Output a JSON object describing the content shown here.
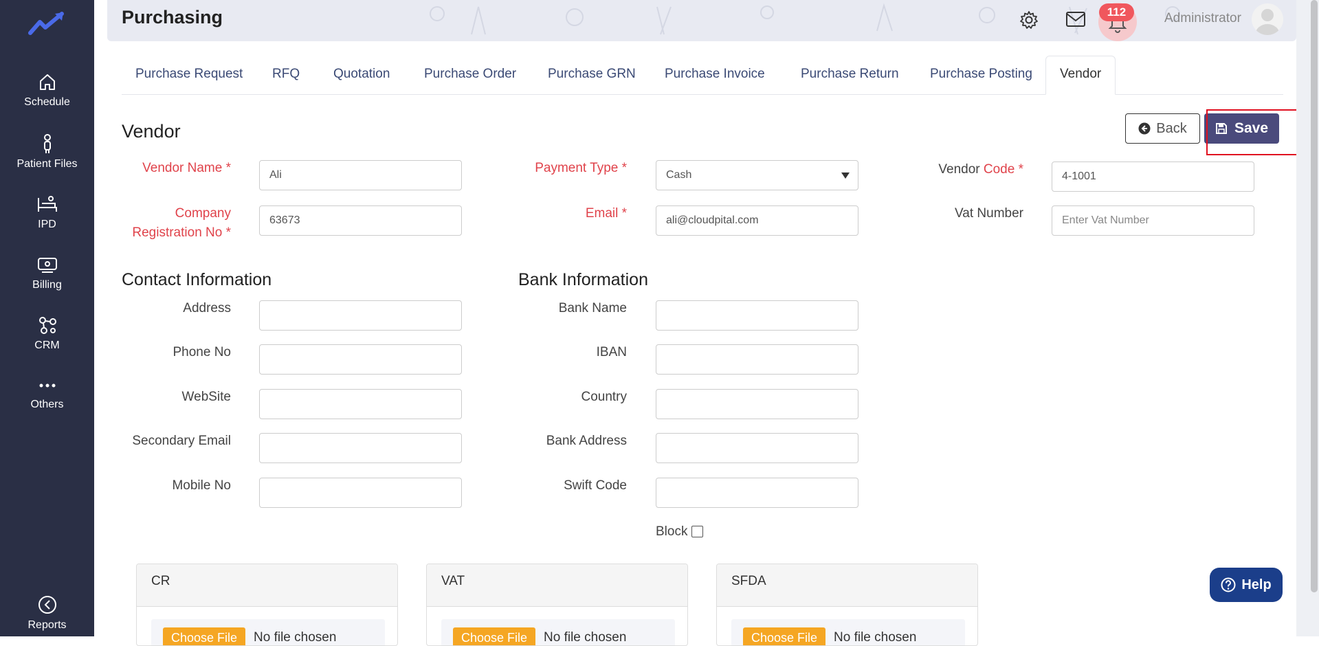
{
  "sidebar": {
    "items": [
      {
        "label": "Schedule",
        "icon": "home-icon"
      },
      {
        "label": "Patient Files",
        "icon": "patient-icon"
      },
      {
        "label": "IPD",
        "icon": "bed-icon"
      },
      {
        "label": "Billing",
        "icon": "billing-icon"
      },
      {
        "label": "CRM",
        "icon": "crm-icon"
      },
      {
        "label": "Others",
        "icon": "more-icon"
      }
    ],
    "bottom": {
      "label": "Reports",
      "icon": "reports-icon"
    }
  },
  "header": {
    "title": "Purchasing",
    "notification_count": "112",
    "user_name": "Administrator"
  },
  "tabs": [
    {
      "label": "Purchase Request"
    },
    {
      "label": "RFQ"
    },
    {
      "label": "Quotation"
    },
    {
      "label": "Purchase Order"
    },
    {
      "label": "Purchase GRN"
    },
    {
      "label": "Purchase Invoice"
    },
    {
      "label": "Purchase Return"
    },
    {
      "label": "Purchase Posting"
    },
    {
      "label": "Vendor"
    }
  ],
  "form": {
    "title": "Vendor",
    "back_label": "Back",
    "save_label": "Save",
    "vendor_name": {
      "label": "Vendor Name *",
      "value": "Ali"
    },
    "company_reg": {
      "label_line1": "Company",
      "label_line2": "Registration No *",
      "value": "63673"
    },
    "payment_type": {
      "label": "Payment Type *",
      "value": "Cash"
    },
    "email": {
      "label": "Email *",
      "value": "ali@cloudpital.com"
    },
    "vendor_code": {
      "label_plain": "Vendor ",
      "label_red": "Code *",
      "value": "4-1001"
    },
    "vat_number": {
      "label": "Vat Number",
      "placeholder": "Enter Vat Number"
    }
  },
  "contact": {
    "title": "Contact Information",
    "fields": [
      {
        "label": "Address",
        "value": ""
      },
      {
        "label": "Phone No",
        "value": ""
      },
      {
        "label": "WebSite",
        "value": ""
      },
      {
        "label": "Secondary Email",
        "value": ""
      },
      {
        "label": "Mobile No",
        "value": ""
      }
    ]
  },
  "bank": {
    "title": "Bank Information",
    "fields": [
      {
        "label": "Bank Name",
        "value": ""
      },
      {
        "label": "IBAN",
        "value": ""
      },
      {
        "label": "Country",
        "value": ""
      },
      {
        "label": "Bank Address",
        "value": ""
      },
      {
        "label": "Swift Code",
        "value": ""
      }
    ],
    "block_label": "Block"
  },
  "documents": [
    {
      "title": "CR",
      "button": "Choose File",
      "status": "No file chosen"
    },
    {
      "title": "VAT",
      "button": "Choose File",
      "status": "No file chosen"
    },
    {
      "title": "SFDA",
      "button": "Choose File",
      "status": "No file chosen"
    }
  ],
  "help_label": "Help",
  "colors": {
    "sidebar": "#2a2f45",
    "accent": "#4a4a7c",
    "required": "#e0434b",
    "badge": "#f0575d",
    "help": "#1b3e8a",
    "file_button": "#f5a623"
  }
}
